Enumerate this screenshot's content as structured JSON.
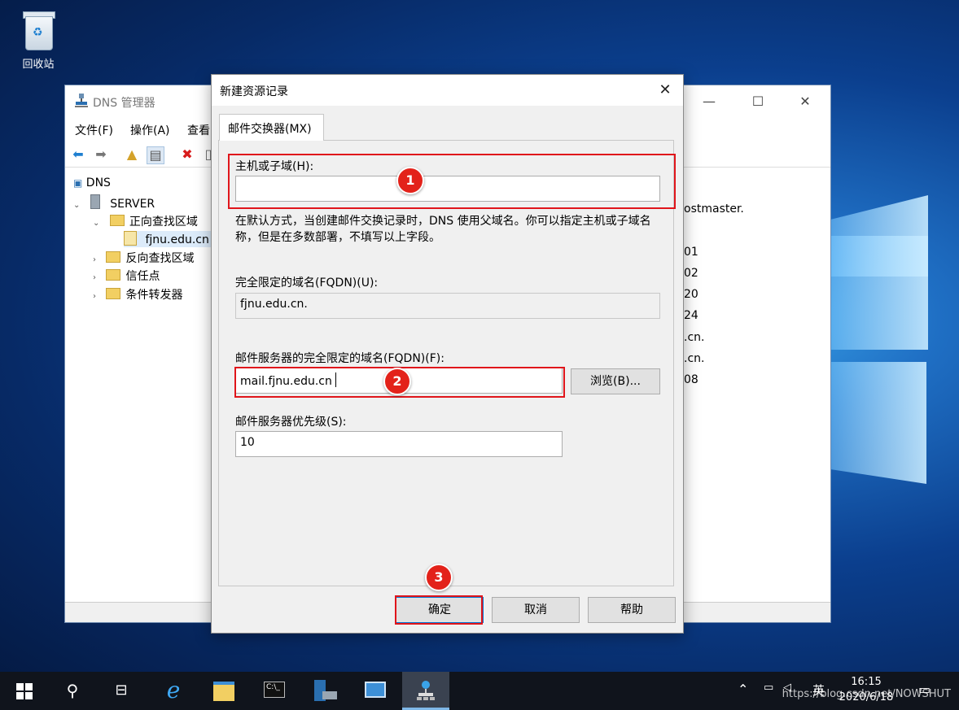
{
  "desktop": {
    "recycle_bin_label": "回收站"
  },
  "mmc": {
    "title": "DNS 管理器",
    "menu": [
      "文件(F)",
      "操作(A)",
      "查看"
    ],
    "tree": {
      "root": "DNS",
      "server": "SERVER",
      "forward_zones": "正向查找区域",
      "zone": "fjnu.edu.cn",
      "reverse_zones": "反向查找区域",
      "trust_points": "信任点",
      "conditional_forwarders": "条件转发器"
    },
    "right_values": [
      "ostmaster.",
      "01",
      "02",
      "20",
      "24",
      ".cn.",
      ".cn.",
      "08"
    ]
  },
  "dialog": {
    "title": "新建资源记录",
    "tab": "邮件交换器(MX)",
    "host_label": "主机或子域(H):",
    "host_value": "",
    "hint": "在默认方式，当创建邮件交换记录时，DNS 使用父域名。你可以指定主机或子域名称，但是在多数部署，不填写以上字段。",
    "fqdn_label": "完全限定的域名(FQDN)(U):",
    "fqdn_value": "fjnu.edu.cn.",
    "mail_server_label": "邮件服务器的完全限定的域名(FQDN)(F):",
    "mail_server_value": "mail.fjnu.edu.cn",
    "browse_button": "浏览(B)...",
    "priority_label": "邮件服务器优先级(S):",
    "priority_value": "10",
    "ok_button": "确定",
    "cancel_button": "取消",
    "help_button": "帮助",
    "badges": [
      "1",
      "2",
      "3"
    ]
  },
  "taskbar": {
    "ime": "英",
    "time": "16:15",
    "date": "2020/6/18",
    "watermark": "https://blog.csdn.net/NOWSHUT"
  },
  "colors": {
    "highlight": "#e0151b",
    "desktop": "#0b3f8e"
  }
}
